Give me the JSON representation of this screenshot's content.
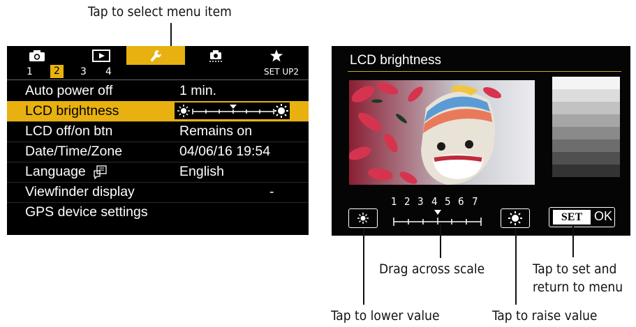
{
  "callouts": {
    "select_menu_item": "Tap to select menu item",
    "drag_scale": "Drag across scale",
    "set_return": "Tap to set and",
    "set_return_2": "return to menu",
    "lower_value": "Tap to lower value",
    "raise_value": "Tap to raise value"
  },
  "menu": {
    "tab_icons": [
      "camera-icon",
      "playback-icon",
      "wrench-icon",
      "custom-function-icon",
      "star-icon"
    ],
    "active_tab": 2,
    "subtabs": [
      "1",
      "2",
      "3",
      "4"
    ],
    "active_subtab": "2",
    "page_label": "SET UP2",
    "items": [
      {
        "label": "Auto power off",
        "value": "1 min."
      },
      {
        "label": "LCD brightness",
        "value": ""
      },
      {
        "label": "LCD off/on btn",
        "value": "Remains on"
      },
      {
        "label": "Date/Time/Zone",
        "value": "04/06/16 19:54"
      },
      {
        "label": "Language",
        "value": "English"
      },
      {
        "label": "Viewfinder display",
        "value": "-"
      },
      {
        "label": "GPS device settings",
        "value": ""
      }
    ],
    "selected_item": 1,
    "brightness_level": 4,
    "brightness_max": 7
  },
  "brightness_screen": {
    "title": "LCD brightness",
    "scale_numbers": [
      "1",
      "2",
      "3",
      "4",
      "5",
      "6",
      "7"
    ],
    "current_level": 4,
    "set_label": "SET",
    "ok_label": "OK"
  },
  "colors": {
    "accent": "#e8b10f",
    "rule": "#d4a52a"
  }
}
